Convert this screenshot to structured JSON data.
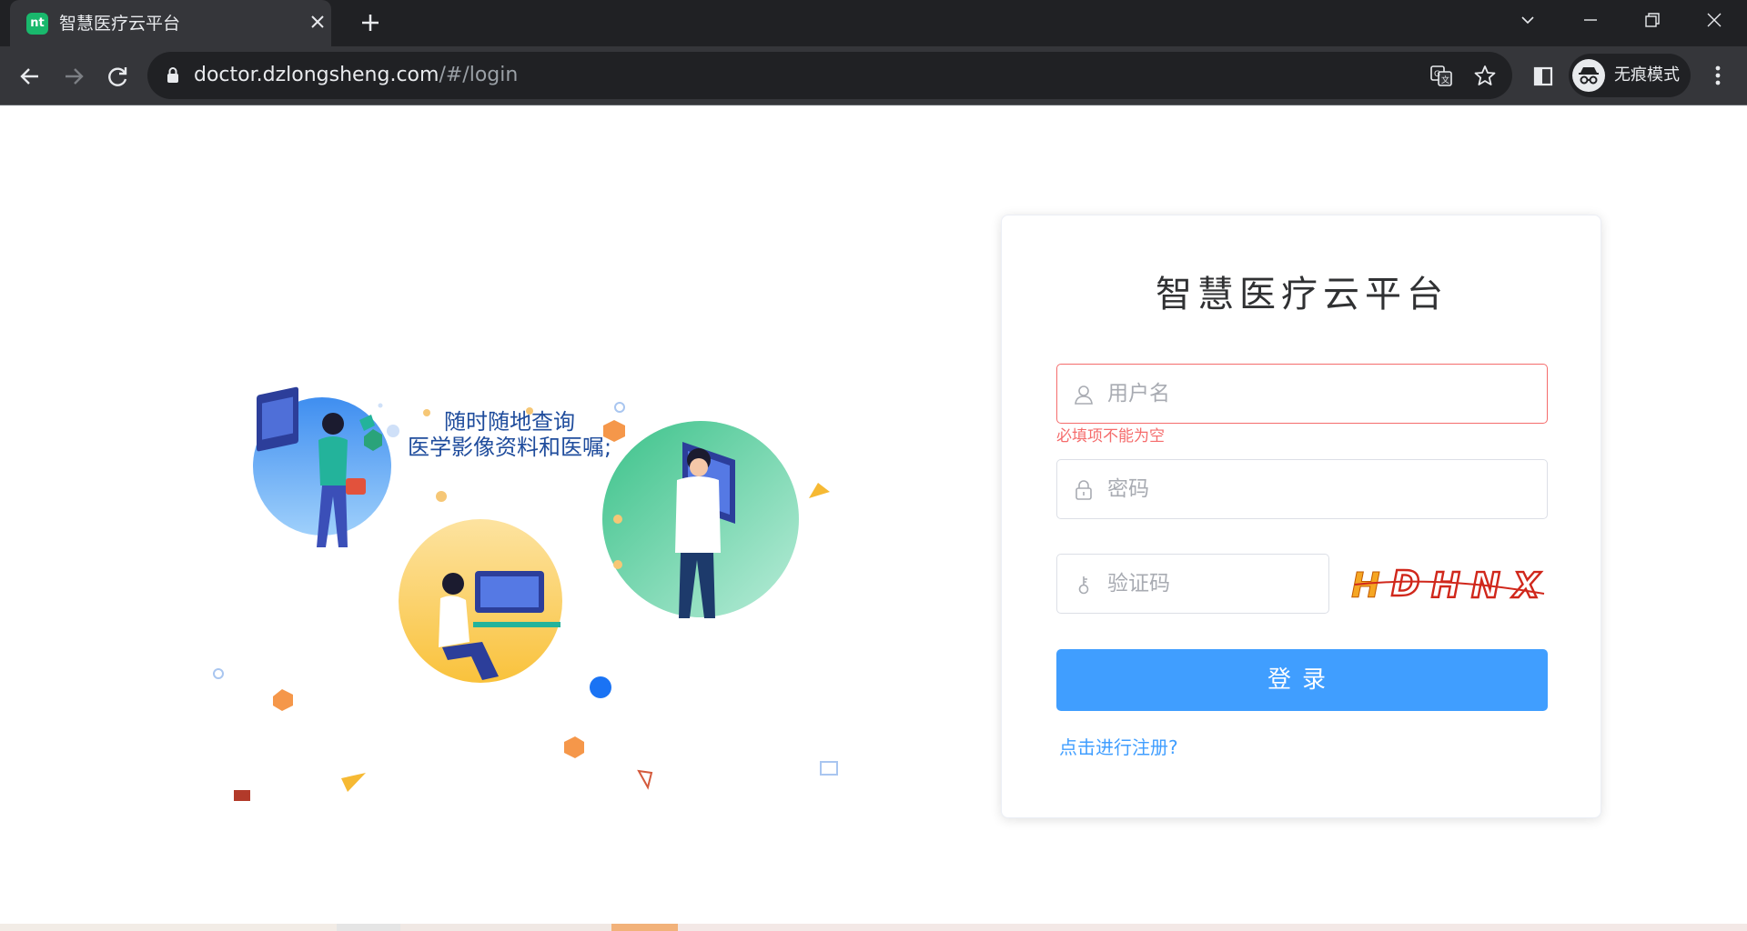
{
  "browser": {
    "tab": {
      "title": "智慧医疗云平台",
      "favicon": "nt"
    },
    "url_host": "doctor.dzlongsheng.com",
    "url_path": "/#/login",
    "incognito_label": "无痕模式"
  },
  "illustration": {
    "slogan_line1": "随时随地查询",
    "slogan_line2": "医学影像资料和医嘱;"
  },
  "login": {
    "title": "智慧医疗云平台",
    "username_placeholder": "用户名",
    "username_value": "",
    "username_error": "必填项不能为空",
    "password_placeholder": "密码",
    "password_value": "",
    "captcha_placeholder": "验证码",
    "captcha_value": "",
    "captcha_image_text": "HDHNX",
    "submit_label": "登录",
    "register_link": "点击进行注册?"
  },
  "colors": {
    "primary": "#409eff",
    "error": "#f56c6c",
    "title": "#303133",
    "slogan": "#1f4c9c"
  }
}
